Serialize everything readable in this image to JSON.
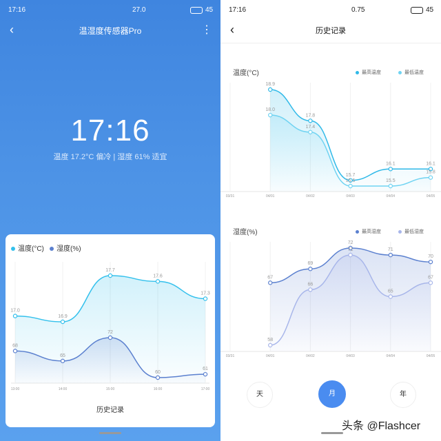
{
  "left": {
    "status": {
      "time": "17:16",
      "speed": "27.0",
      "battery": "45"
    },
    "title": "温湿度传感器Pro",
    "clock": "17:16",
    "status_text": "温度 17.2°C 偏冷 | 湿度 61% 适宜",
    "legend": {
      "temp": "温度(°C)",
      "hum": "湿度(%)"
    },
    "history": "历史记录",
    "colors": {
      "temp": "#33c0ec",
      "hum": "#5b80cf"
    }
  },
  "right": {
    "status": {
      "time": "17:16",
      "speed": "0.75",
      "battery": "45"
    },
    "title": "历史记录",
    "temp_section": "温度(°C)",
    "hum_section": "湿度(%)",
    "legend": {
      "max_temp": "最高温度",
      "min_temp": "最低温度",
      "max_hum": "最高湿度",
      "min_hum": "最低湿度"
    },
    "periods": {
      "day": "天",
      "month": "月",
      "year": "年"
    },
    "active_period": "month",
    "colors": {
      "max_temp": "#2fb9e8",
      "min_temp": "#6fd3f2",
      "max_hum": "#5b80cf",
      "min_hum": "#a8b6ea"
    }
  },
  "watermark": "头条 @Flashcer",
  "chart_data": [
    {
      "type": "area",
      "categories": [
        "13:00",
        "14:00",
        "15:00",
        "16:00",
        "17:00"
      ],
      "series": [
        {
          "name": "温度(°C)",
          "values": [
            17.0,
            16.9,
            17.7,
            17.6,
            17.3
          ]
        },
        {
          "name": "湿度(%)",
          "values": [
            68,
            65,
            72,
            60,
            61
          ]
        }
      ]
    },
    {
      "type": "area",
      "categories": [
        "03/31",
        "04/01",
        "04/02",
        "04/03",
        "04/04",
        "04/05"
      ],
      "series": [
        {
          "name": "最高温度",
          "values": [
            null,
            18.9,
            17.8,
            15.7,
            16.1,
            16.1
          ]
        },
        {
          "name": "最低温度",
          "values": [
            null,
            18.0,
            17.4,
            15.5,
            15.5,
            15.8
          ]
        }
      ]
    },
    {
      "type": "area",
      "categories": [
        "03/31",
        "04/01",
        "04/02",
        "04/03",
        "04/04",
        "04/05"
      ],
      "series": [
        {
          "name": "最高湿度",
          "values": [
            null,
            67,
            69,
            72,
            71,
            70
          ]
        },
        {
          "name": "最低湿度",
          "values": [
            null,
            58,
            66,
            71,
            65,
            67
          ]
        }
      ]
    }
  ]
}
